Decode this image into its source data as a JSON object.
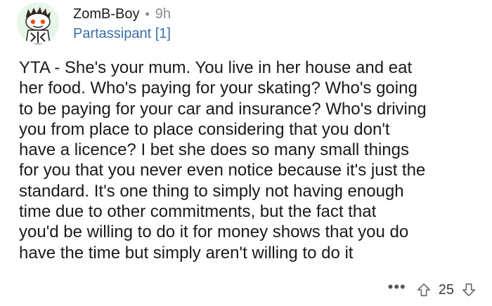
{
  "comment": {
    "author": "ZomB-Boy",
    "time": "9h",
    "flair": "Partassipant [1]",
    "body": "YTA - She's your mum. You live in her house and eat\nher food. Who's paying for your skating? Who's going\nto be paying for your car and insurance? Who's driving\nyou from place to place considering that you don't\nhave a licence? I bet she does so many small things\nfor you that you never even notice because it's just the\nstandard. It's one thing to simply not having enough\ntime due to other commitments, but the fact that\nyou'd be willing to do it for money shows that you do\nhave the time but simply aren't willing to do it",
    "score": "25"
  },
  "ui": {
    "separator": "•",
    "more": "•••"
  },
  "icons": {
    "avatar": "snoo-avatar",
    "upvote": "upvote-arrow-icon",
    "downvote": "downvote-arrow-icon",
    "more": "more-options-icon"
  },
  "colors": {
    "flair": "#3b6fa8",
    "meta": "#878a8c",
    "text": "#1a1a1b"
  }
}
